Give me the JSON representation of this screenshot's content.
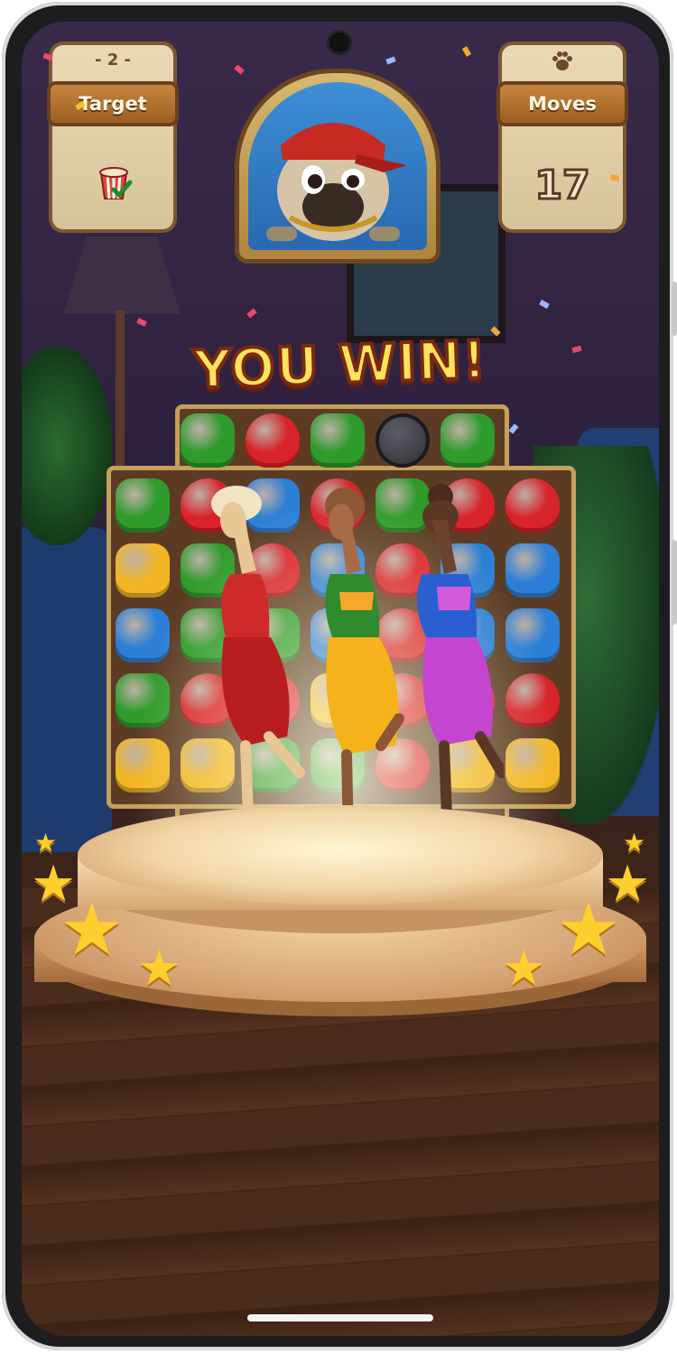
{
  "hud": {
    "level": "- 2 -",
    "target_label": "Target",
    "moves_label": "Moves",
    "moves_value": "17",
    "paw_icon": "paw-icon",
    "target_icon": "popcorn-bucket-icon"
  },
  "banner": {
    "text": "YOU WIN!"
  },
  "colors": {
    "green": "#2e9b2a",
    "red": "#d8232a",
    "blue": "#2c7fd6",
    "yellow": "#f2b624",
    "panel": "#e3d1a9",
    "label": "#b06e2e"
  },
  "board": {
    "rows": [
      [
        "",
        "green",
        "red",
        "green",
        "bomb",
        "green",
        ""
      ],
      [
        "green",
        "red",
        "blue",
        "red",
        "green",
        "red",
        "red"
      ],
      [
        "yellow",
        "green",
        "red",
        "blue",
        "red",
        "blue",
        "blue"
      ],
      [
        "blue",
        "green",
        "green",
        "blue",
        "red",
        "blue",
        "blue"
      ],
      [
        "green",
        "red",
        "red",
        "yellow",
        "red",
        "red",
        "red"
      ],
      [
        "yellow",
        "yellow",
        "green",
        "green",
        "red",
        "yellow",
        "yellow"
      ]
    ]
  }
}
